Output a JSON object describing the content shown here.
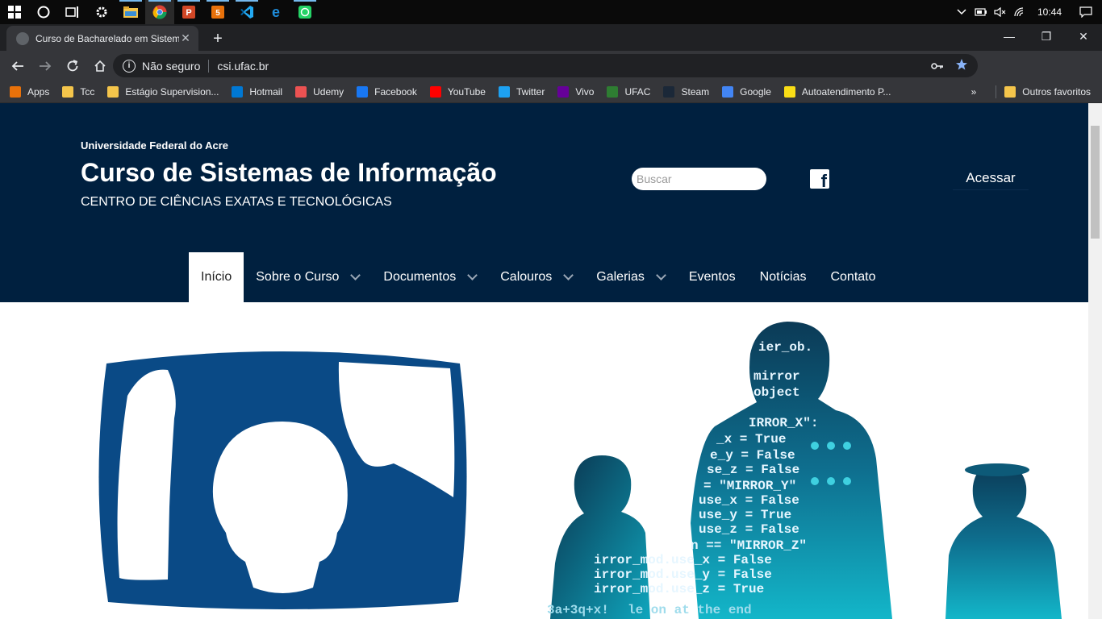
{
  "taskbar": {
    "clock": "10:44"
  },
  "browser": {
    "tab_title": "Curso de Bacharelado em Sistem",
    "url_security": "Não seguro",
    "url": "csi.ufac.br"
  },
  "bookmarks": {
    "items": [
      {
        "label": "Apps",
        "icon": "apps-grid-icon",
        "color": "#e8710a"
      },
      {
        "label": "Tcc",
        "icon": "folder-icon",
        "color": "#f4c54b"
      },
      {
        "label": "Estágio Supervision...",
        "icon": "folder-icon",
        "color": "#f4c54b"
      },
      {
        "label": "Hotmail",
        "icon": "outlook-icon",
        "color": "#0078d4"
      },
      {
        "label": "Udemy",
        "icon": "udemy-icon",
        "color": "#ec5252"
      },
      {
        "label": "Facebook",
        "icon": "facebook-icon",
        "color": "#1877f2"
      },
      {
        "label": "YouTube",
        "icon": "youtube-icon",
        "color": "#ff0000"
      },
      {
        "label": "Twitter",
        "icon": "twitter-icon",
        "color": "#1da1f2"
      },
      {
        "label": "Vivo",
        "icon": "vivo-icon",
        "color": "#660099"
      },
      {
        "label": "UFAC",
        "icon": "ufac-icon",
        "color": "#2e7d32"
      },
      {
        "label": "Steam",
        "icon": "steam-icon",
        "color": "#1b2838"
      },
      {
        "label": "Google",
        "icon": "google-icon",
        "color": "#4285f4"
      },
      {
        "label": "Autoatendimento P...",
        "icon": "bb-icon",
        "color": "#f9dd16"
      }
    ],
    "other": "Outros favoritos"
  },
  "site": {
    "university": "Universidade Federal do Acre",
    "course": "Curso de Sistemas de Informação",
    "center": "CENTRO DE CIÊNCIAS EXATAS E TECNOLÓGICAS",
    "search_placeholder": "Buscar",
    "login": "Acessar",
    "header_color": "#00203f",
    "logo_color": "#0a4a86"
  },
  "nav": {
    "items": [
      {
        "label": "Início",
        "dropdown": false,
        "active": true
      },
      {
        "label": "Sobre o Curso",
        "dropdown": true
      },
      {
        "label": "Documentos",
        "dropdown": true
      },
      {
        "label": "Calouros",
        "dropdown": true
      },
      {
        "label": "Galerias",
        "dropdown": true
      },
      {
        "label": "Eventos",
        "dropdown": false
      },
      {
        "label": "Notícias",
        "dropdown": false
      },
      {
        "label": "Contato",
        "dropdown": false
      }
    ]
  },
  "hero": {
    "code_lines": [
      "ier_ob.",
      "mirror",
      "object",
      "IRROR_X\":",
      "_x = True",
      "e_y = False",
      "se_z = False",
      "= \"MIRROR_Y\"",
      "use_x = False",
      "use_y = True",
      "use_z = False",
      "n == \"MIRROR_Z\"",
      "irror_mod.use_x = False",
      "irror_mod.use_y = False",
      "irror_mod.use_z = True",
      "3a+3q+x!",
      "le   on at the end"
    ]
  }
}
